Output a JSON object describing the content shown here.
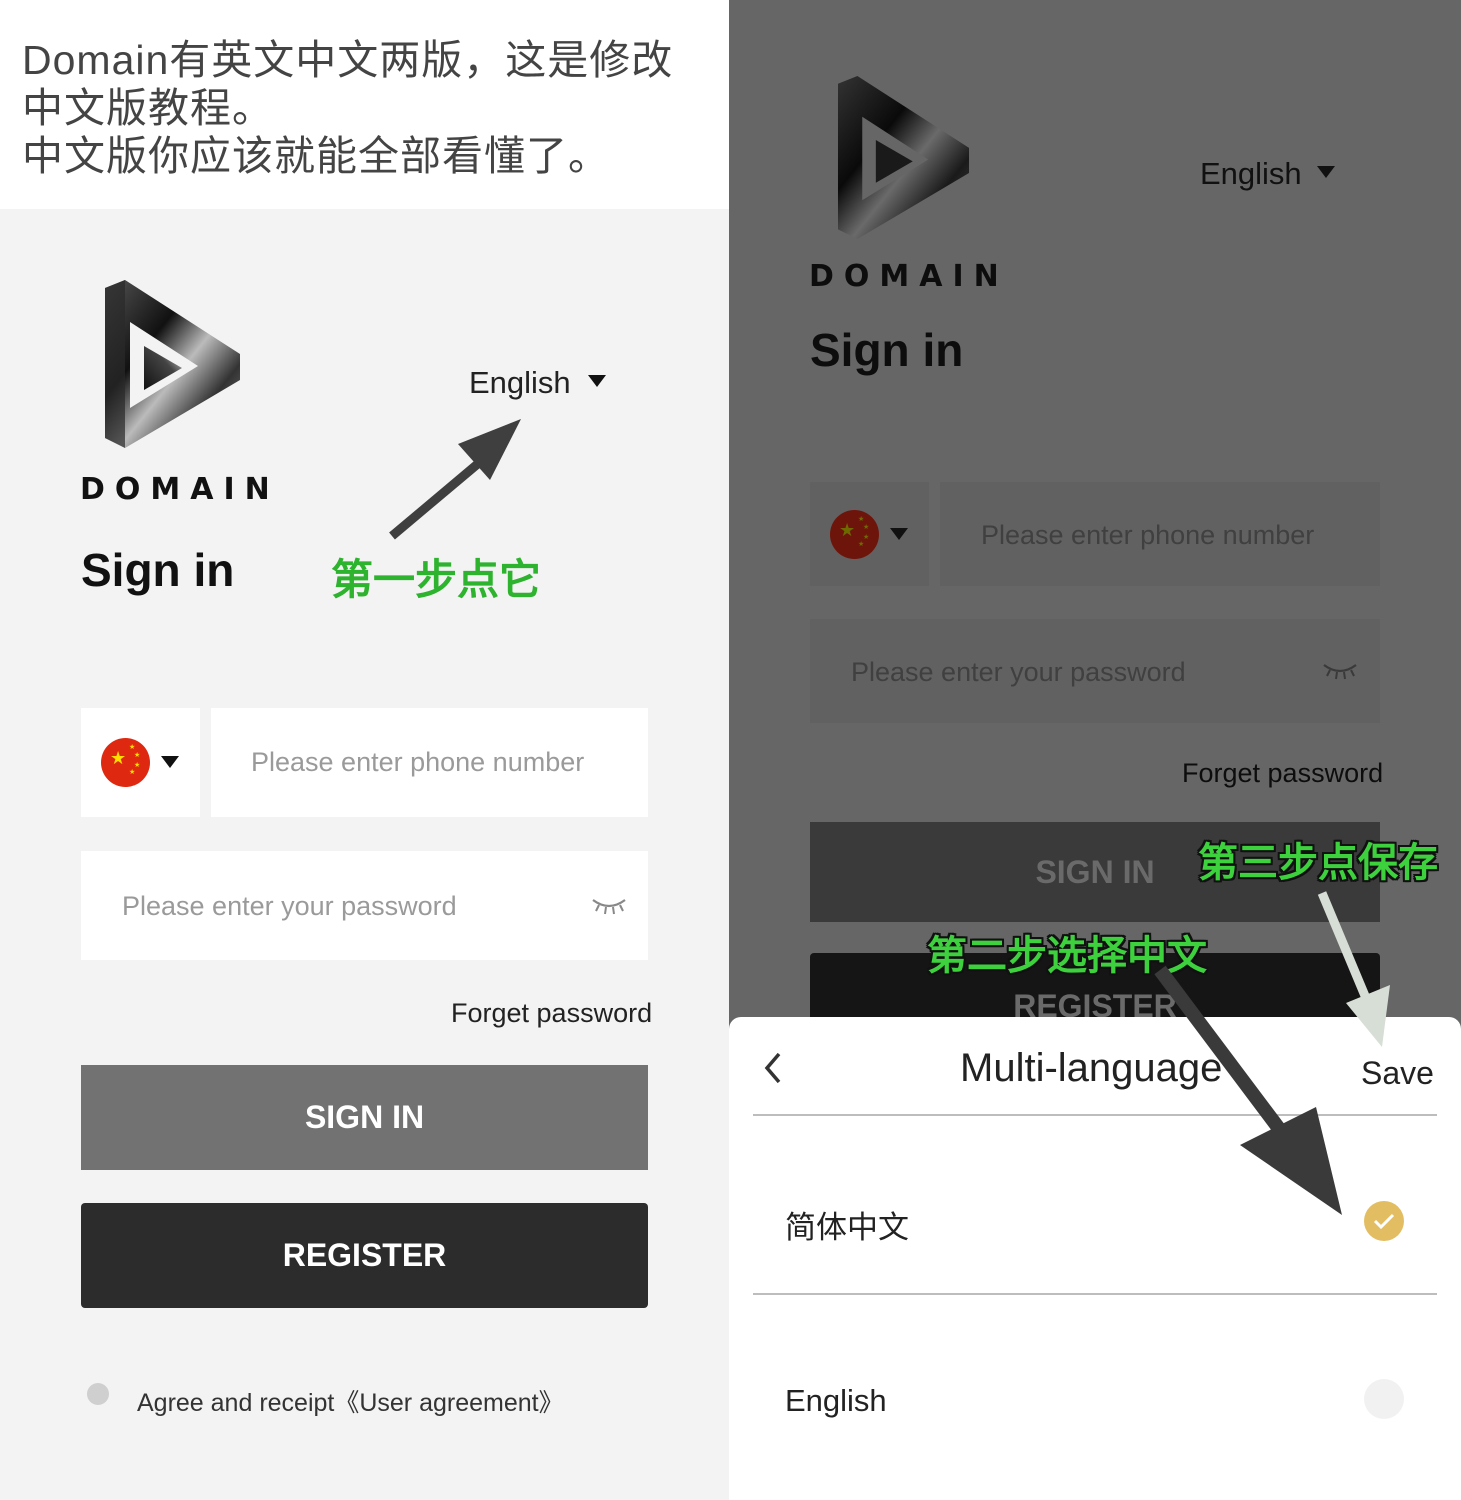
{
  "intro": {
    "lines": [
      "Domain有英文中文两版，这是修改",
      "中文版教程。",
      "中文版你应该就能全部看懂了。"
    ]
  },
  "left": {
    "brand": "DOMAIN",
    "language_selector": "English",
    "title": "Sign in",
    "annotation_step1": "第一步点它",
    "country_flag_icon": "china-flag-icon",
    "phone_placeholder": "Please enter phone number",
    "password_placeholder": "Please enter your password",
    "forget_password": "Forget password",
    "sign_in_button": "SIGN IN",
    "register_button": "REGISTER",
    "agreement_text": "Agree and receipt《User agreement》"
  },
  "right": {
    "brand": "DOMAIN",
    "language_selector": "English",
    "title": "Sign in",
    "phone_placeholder": "Please enter phone number",
    "password_placeholder": "Please enter your password",
    "forget_password": "Forget password",
    "sign_in_button": "SIGN IN",
    "register_button": "REGISTER",
    "annotation_step3": "第三步点保存",
    "annotation_step2": "第二步选择中文",
    "sheet": {
      "title": "Multi-language",
      "save": "Save",
      "options": [
        {
          "label": "简体中文",
          "selected": true
        },
        {
          "label": "English",
          "selected": false
        }
      ]
    }
  },
  "colors": {
    "accent_check": "#e2bd62",
    "annotation_green": "#2db32d",
    "sign_in_button": "#727272",
    "register_button": "#2c2c2d"
  }
}
